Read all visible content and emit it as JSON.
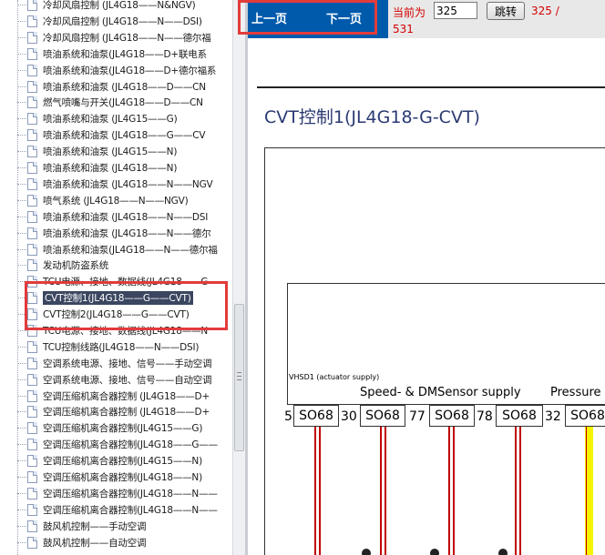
{
  "tree": {
    "items": [
      {
        "label": "冷却风扇控制 (JL4G18——N&NGV)"
      },
      {
        "label": "冷却风扇控制 (JL4G18——N——DSI)"
      },
      {
        "label": "冷却风扇控制 (JL4G18——N——德尔福"
      },
      {
        "label": "喷油系统和油泵(JL4G18——D+联电系"
      },
      {
        "label": "喷油系统和油泵(JL4G18——D+德尔福系"
      },
      {
        "label": "喷油系统和油泵 (JL4G18——D——CN"
      },
      {
        "label": "燃气喷嘴与开关(JL4G18——D——CN"
      },
      {
        "label": "喷油系统和油泵 (JL4G15——G)"
      },
      {
        "label": "喷油系统和油泵 (JL4G18——G——CV"
      },
      {
        "label": "喷油系统和油泵 (JL4G15——N)"
      },
      {
        "label": "喷油系统和油泵 (JL4G18——N)"
      },
      {
        "label": "喷油系统和油泵 (JL4G18——N——NGV"
      },
      {
        "label": "喷气系统 (JL4G18——N——NGV)"
      },
      {
        "label": "喷油系统和油泵 (JL4G18——N——DSI"
      },
      {
        "label": "喷油系统和油泵 (JL4G18——N——德尔"
      },
      {
        "label": "喷油系统和油泵(JL4G18——N——德尔福"
      },
      {
        "label": "发动机防盗系统"
      },
      {
        "label": "TCU电源、接地、数据线(JL4G18——G"
      },
      {
        "label": "CVT控制1(JL4G18——G——CVT)",
        "selected": true
      },
      {
        "label": "CVT控制2(JL4G18——G——CVT)"
      },
      {
        "label": "TCU电源、接地、数据线(JL4G18——N"
      },
      {
        "label": "TCU控制线路(JL4G18——N——DSI)"
      },
      {
        "label": "空调系统电源、接地、信号——手动空调"
      },
      {
        "label": "空调系统电源、接地、信号——自动空调"
      },
      {
        "label": "空调压缩机离合器控制 (JL4G18——D+"
      },
      {
        "label": "空调压缩机离合器控制 (JL4G18——D+"
      },
      {
        "label": "空调压缩机离合器控制(JL4G15——G)"
      },
      {
        "label": "空调压缩机离合器控制(JL4G18——G——"
      },
      {
        "label": "空调压缩机离合器控制(JL4G15——N)"
      },
      {
        "label": "空调压缩机离合器控制(JL4G18——N)"
      },
      {
        "label": "空调压缩机离合器控制(JL4G18——N——"
      },
      {
        "label": "空调压缩机离合器控制(JL4G18——N——"
      },
      {
        "label": "鼓风机控制——手动空调"
      },
      {
        "label": "鼓风机控制——自动空调"
      }
    ]
  },
  "nav": {
    "prev_label": "上一页",
    "next_label": "下一页",
    "current_label": "当前为",
    "page_value": "325",
    "jump_label": "跳转",
    "page_count": "325 /",
    "page_total": "531"
  },
  "document": {
    "title": "CVT控制1(JL4G18-G-CVT)",
    "vhsd_label": "VHSD1 (actuator supply)",
    "signal_labels": [
      "Speed- & DMSensor supply",
      "Pressure"
    ],
    "pins": [
      {
        "num": "5",
        "box": "SO68"
      },
      {
        "num": "30",
        "box": "SO68"
      },
      {
        "num": "77",
        "box": "SO68"
      },
      {
        "num": "78",
        "box": "SO68"
      },
      {
        "num": "32",
        "box": "SO68"
      }
    ]
  },
  "colors": {
    "nav_bar": "#005aab",
    "annotation": "#e23b3b",
    "selection": "#3b4660",
    "wire_red": "#c00000",
    "wire_yellow": "#f5f500"
  }
}
